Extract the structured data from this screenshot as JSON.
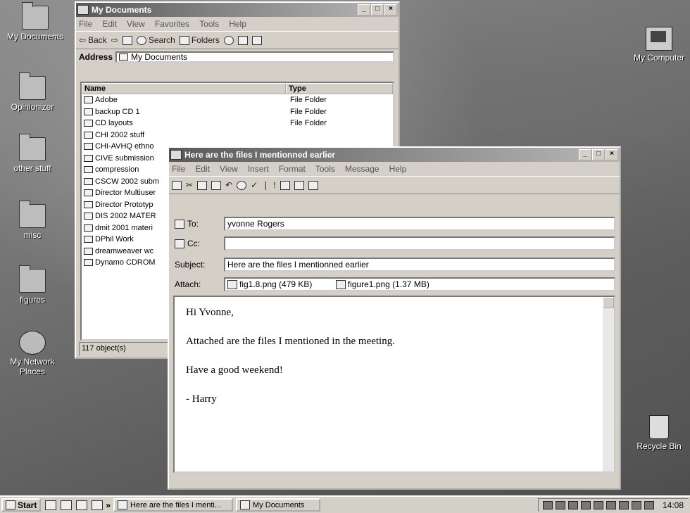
{
  "desktop": {
    "icons": [
      {
        "label": "My Documents"
      },
      {
        "label": "Opinionizer"
      },
      {
        "label": "other stuff"
      },
      {
        "label": "misc"
      },
      {
        "label": "figures"
      },
      {
        "label": "My Network Places"
      },
      {
        "label": "My Computer"
      },
      {
        "label": "Recycle Bin"
      }
    ]
  },
  "explorer": {
    "title": "My Documents",
    "menu": [
      "File",
      "Edit",
      "View",
      "Favorites",
      "Tools",
      "Help"
    ],
    "toolbar": {
      "back": "Back",
      "search": "Search",
      "folders": "Folders"
    },
    "address_label": "Address",
    "address_value": "My Documents",
    "columns": [
      "Name",
      "Type"
    ],
    "rows": [
      {
        "name": "Adobe",
        "type": "File Folder"
      },
      {
        "name": "backup CD 1",
        "type": "File Folder"
      },
      {
        "name": "CD layouts",
        "type": "File Folder"
      },
      {
        "name": "CHI 2002 stuff",
        "type": ""
      },
      {
        "name": "CHI-AVHQ ethno",
        "type": ""
      },
      {
        "name": "CIVE submission",
        "type": ""
      },
      {
        "name": "compression",
        "type": ""
      },
      {
        "name": "CSCW 2002 subm",
        "type": ""
      },
      {
        "name": "Director Multiuser",
        "type": ""
      },
      {
        "name": "Director Prototyp",
        "type": ""
      },
      {
        "name": "DIS 2002 MATER",
        "type": ""
      },
      {
        "name": "dmit 2001 materi",
        "type": ""
      },
      {
        "name": "DPhil Work",
        "type": ""
      },
      {
        "name": "dreamweaver wc",
        "type": ""
      },
      {
        "name": "Dynamo CDROM",
        "type": ""
      }
    ],
    "status": "117 object(s)"
  },
  "email": {
    "title": "Here are the files I mentionned earlier",
    "menu": [
      "File",
      "Edit",
      "View",
      "Insert",
      "Format",
      "Tools",
      "Message",
      "Help"
    ],
    "to_label": "To:",
    "to_value": "yvonne Rogers",
    "cc_label": "Cc:",
    "cc_value": "",
    "subject_label": "Subject:",
    "subject_value": "Here are the files I mentionned earlier",
    "attach_label": "Attach:",
    "attachments": [
      {
        "label": "fig1.8.png (479 KB)"
      },
      {
        "label": "figure1.png (1.37 MB)"
      }
    ],
    "body_lines": [
      "Hi Yvonne,",
      "Attached are the files I mentioned in the meeting.",
      "Have a good weekend!",
      "- Harry"
    ]
  },
  "taskbar": {
    "start": "Start",
    "more": "»",
    "tasks": [
      {
        "label": "Here are the files I menti..."
      },
      {
        "label": "My Documents"
      }
    ],
    "clock": "14:08"
  }
}
